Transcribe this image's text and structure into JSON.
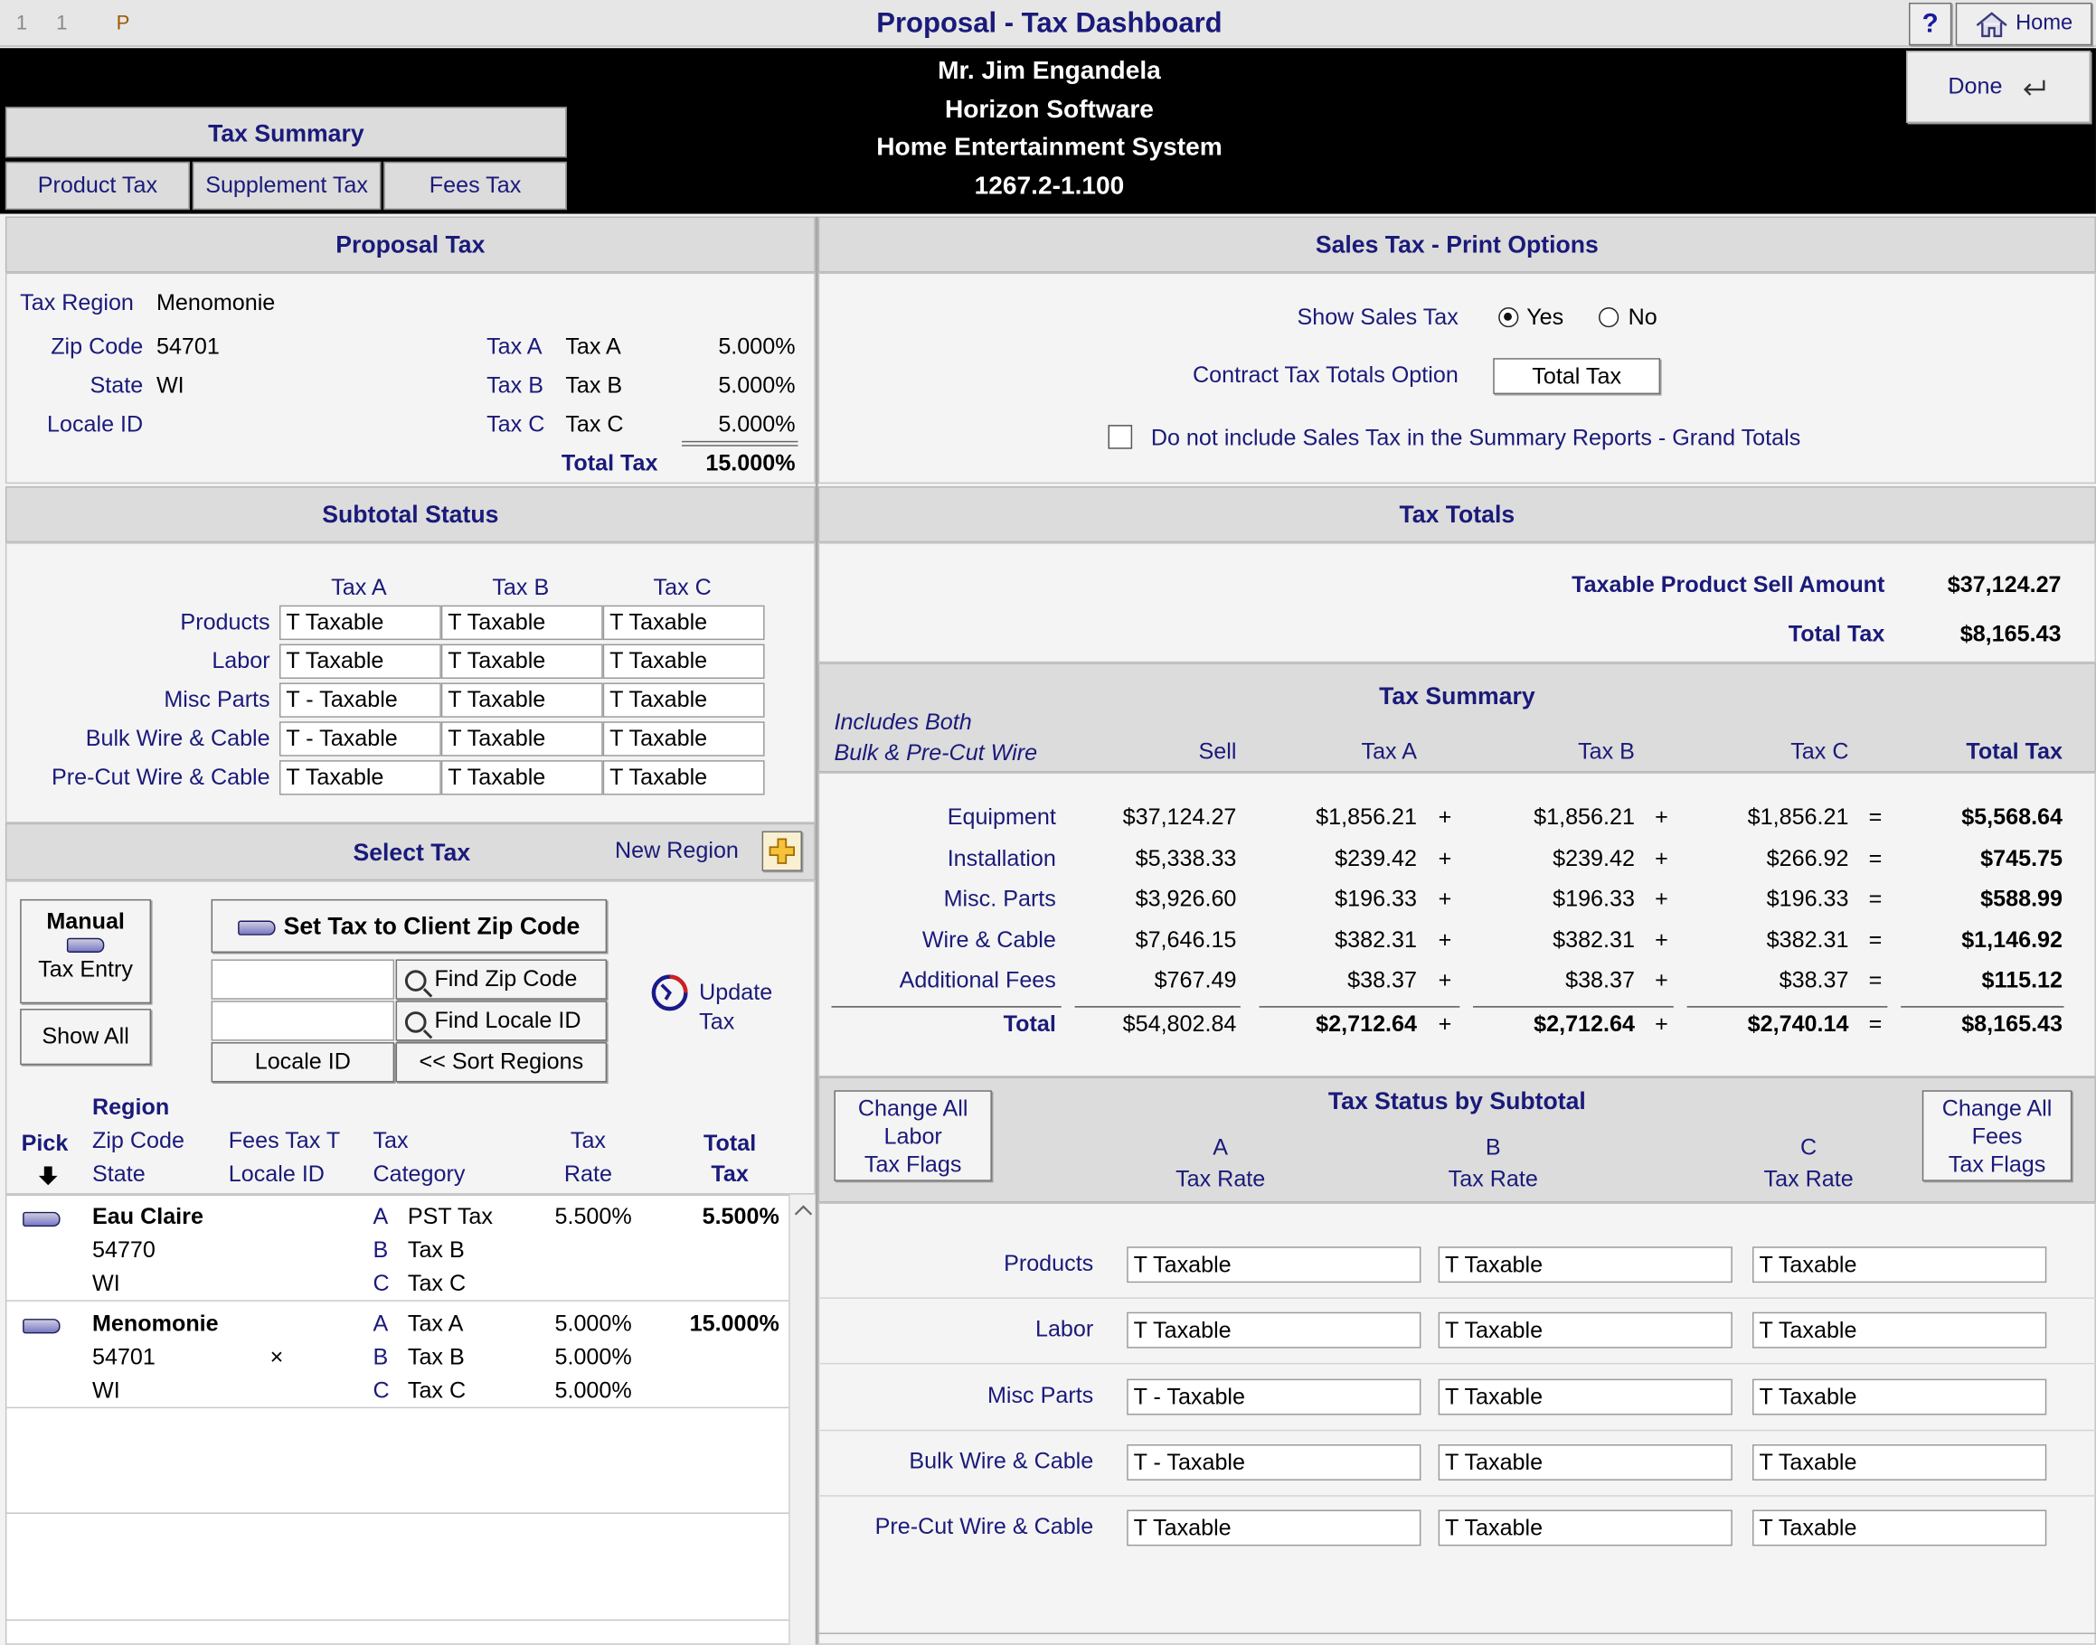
{
  "titlebar": {
    "counter1": "1",
    "counter2": "1",
    "mode": "P",
    "title": "Proposal - Tax Dashboard",
    "help": "?",
    "home": "Home"
  },
  "banner": {
    "lines": [
      "Mr. Jim Engandela",
      "Horizon Software",
      "Home Entertainment System",
      "1267.2-1.100"
    ],
    "done": "Done"
  },
  "tabs": {
    "header": "Tax Summary",
    "items": [
      "Product Tax",
      "Supplement Tax",
      "Fees Tax"
    ]
  },
  "proposal_tax": {
    "header": "Proposal Tax",
    "tax_region_label": "Tax Region",
    "tax_region": "Menomonie",
    "zip_label": "Zip Code",
    "zip": "54701",
    "state_label": "State",
    "state": "WI",
    "locale_label": "Locale ID",
    "locale": "",
    "rates": [
      {
        "code": "Tax A",
        "name": "Tax A",
        "rate": "5.000%"
      },
      {
        "code": "Tax B",
        "name": "Tax B",
        "rate": "5.000%"
      },
      {
        "code": "Tax C",
        "name": "Tax C",
        "rate": "5.000%"
      }
    ],
    "total_label": "Total Tax",
    "total": "15.000%"
  },
  "subtotal_status": {
    "header": "Subtotal Status",
    "cols": [
      "Tax A",
      "Tax B",
      "Tax C"
    ],
    "rows": [
      {
        "label": "Products",
        "vals": [
          "T  Taxable",
          "T  Taxable",
          "T  Taxable"
        ]
      },
      {
        "label": "Labor",
        "vals": [
          "T  Taxable",
          "T  Taxable",
          "T  Taxable"
        ]
      },
      {
        "label": "Misc Parts",
        "vals": [
          "T - Taxable",
          "T  Taxable",
          "T  Taxable"
        ]
      },
      {
        "label": "Bulk Wire & Cable",
        "vals": [
          "T - Taxable",
          "T  Taxable",
          "T  Taxable"
        ]
      },
      {
        "label": "Pre-Cut Wire & Cable",
        "vals": [
          "T  Taxable",
          "T  Taxable",
          "T  Taxable"
        ]
      }
    ]
  },
  "select_tax": {
    "header": "Select Tax",
    "new_region": "New Region",
    "manual": "Manual",
    "tax_entry": "Tax Entry",
    "show_all": "Show All",
    "set_zip": "Set Tax to Client Zip Code",
    "find_zip": "Find Zip Code",
    "find_locale": "Find Locale ID",
    "locale_id": "Locale ID",
    "sort_regions": "<< Sort Regions",
    "update": "Update",
    "update2": "Tax",
    "cols": {
      "pick": "Pick",
      "region": "Region",
      "zip": "Zip Code",
      "state": "State",
      "fees": "Fees Tax T",
      "locale": "Locale ID",
      "tax": "Tax",
      "category": "Category",
      "rate1": "Tax",
      "rate2": "Rate",
      "total1": "Total",
      "total2": "Tax"
    },
    "regions": [
      {
        "name": "Eau Claire",
        "zip": "54770",
        "state": "WI",
        "fees": "",
        "total": "5.500%",
        "cats": [
          {
            "l": "A",
            "n": "PST Tax",
            "r": "5.500%"
          },
          {
            "l": "B",
            "n": "Tax B",
            "r": ""
          },
          {
            "l": "C",
            "n": "Tax C",
            "r": ""
          }
        ]
      },
      {
        "name": "Menomonie",
        "zip": "54701",
        "state": "WI",
        "fees": "×",
        "total": "15.000%",
        "cats": [
          {
            "l": "A",
            "n": "Tax A",
            "r": "5.000%"
          },
          {
            "l": "B",
            "n": "Tax B",
            "r": "5.000%"
          },
          {
            "l": "C",
            "n": "Tax C",
            "r": "5.000%"
          }
        ]
      }
    ]
  },
  "print_options": {
    "header": "Sales Tax - Print Options",
    "show_label": "Show Sales Tax",
    "yes": "Yes",
    "no": "No",
    "contract_label": "Contract Tax Totals Option",
    "contract_value": "Total Tax",
    "exclude_label": "Do not include Sales Tax in the Summary Reports - Grand Totals"
  },
  "tax_totals": {
    "header": "Tax Totals",
    "sell_label": "Taxable Product Sell Amount",
    "sell": "$37,124.27",
    "total_label": "Total Tax",
    "total": "$8,165.43"
  },
  "tax_summary": {
    "header": "Tax Summary",
    "note1": "Includes Both",
    "note2": "Bulk & Pre-Cut Wire",
    "cols": [
      "Sell",
      "Tax A",
      "Tax B",
      "Tax C",
      "Total Tax"
    ],
    "rows": [
      {
        "label": "Equipment",
        "vals": [
          "$37,124.27",
          "$1,856.21",
          "$1,856.21",
          "$1,856.21",
          "$5,568.64"
        ]
      },
      {
        "label": "Installation",
        "vals": [
          "$5,338.33",
          "$239.42",
          "$239.42",
          "$266.92",
          "$745.75"
        ]
      },
      {
        "label": "Misc. Parts",
        "vals": [
          "$3,926.60",
          "$196.33",
          "$196.33",
          "$196.33",
          "$588.99"
        ]
      },
      {
        "label": "Wire & Cable",
        "vals": [
          "$7,646.15",
          "$382.31",
          "$382.31",
          "$382.31",
          "$1,146.92"
        ]
      },
      {
        "label": "Additional Fees",
        "vals": [
          "$767.49",
          "$38.37",
          "$38.37",
          "$38.37",
          "$115.12"
        ]
      }
    ],
    "total": {
      "label": "Total",
      "vals": [
        "$54,802.84",
        "$2,712.64",
        "$2,712.64",
        "$2,740.14",
        "$8,165.43"
      ]
    },
    "plus": "+",
    "eq": "="
  },
  "status_by_subtotal": {
    "header": "Tax Status by Subtotal",
    "change_labor": [
      "Change All",
      "Labor",
      "Tax Flags"
    ],
    "change_fees": [
      "Change All",
      "Fees",
      "Tax Flags"
    ],
    "cols": [
      {
        "l": "A",
        "s": "Tax Rate"
      },
      {
        "l": "B",
        "s": "Tax Rate"
      },
      {
        "l": "C",
        "s": "Tax Rate"
      }
    ],
    "rows": [
      {
        "label": "Products",
        "vals": [
          "T  Taxable",
          "T  Taxable",
          "T  Taxable"
        ]
      },
      {
        "label": "Labor",
        "vals": [
          "T  Taxable",
          "T  Taxable",
          "T  Taxable"
        ]
      },
      {
        "label": "Misc Parts",
        "vals": [
          "T - Taxable",
          "T  Taxable",
          "T  Taxable"
        ]
      },
      {
        "label": "Bulk Wire & Cable",
        "vals": [
          "T - Taxable",
          "T  Taxable",
          "T  Taxable"
        ]
      },
      {
        "label": "Pre-Cut Wire & Cable",
        "vals": [
          "T  Taxable",
          "T  Taxable",
          "T  Taxable"
        ]
      }
    ]
  }
}
